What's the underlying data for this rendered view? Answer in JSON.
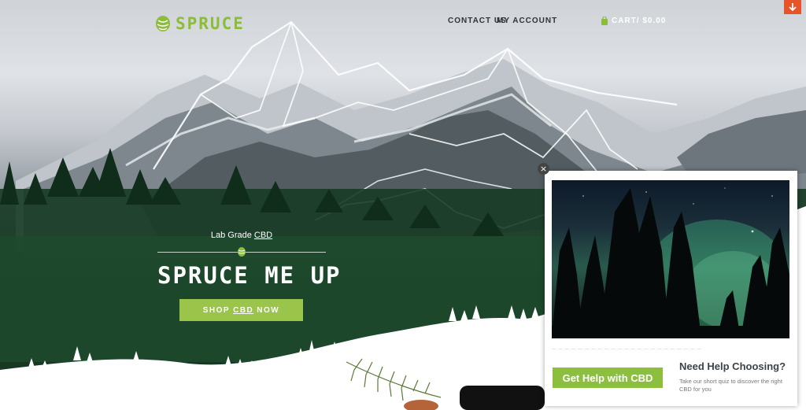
{
  "brand": {
    "name": "SPRUCE",
    "accent": "#8bbd3a"
  },
  "nav": {
    "contact_label": "CONTACT US",
    "account_label": "MY ACCOUNT",
    "cart_label": "CART/ $0.00"
  },
  "hero": {
    "tagline_prefix": "Lab Grade ",
    "tagline_link": "CBD",
    "headline": "SPRUCE ME UP",
    "cta_prefix": "SHOP",
    "cta_link": "CBD",
    "cta_suffix": "NOW",
    "cta_color": "#9bc44a"
  },
  "popup": {
    "button_label": "Get Help with CBD",
    "title": "Need Help Choosing?",
    "subtitle": "Take our short quiz to discover the right CBD for you",
    "close_label": "×"
  },
  "icons": {
    "scroll": "arrow-down-icon",
    "cart": "shopping-bag-icon",
    "logo": "spruce-cone-icon",
    "close": "close-icon"
  },
  "colors": {
    "scroll_button": "#e8542a",
    "headline": "#ffffff"
  }
}
